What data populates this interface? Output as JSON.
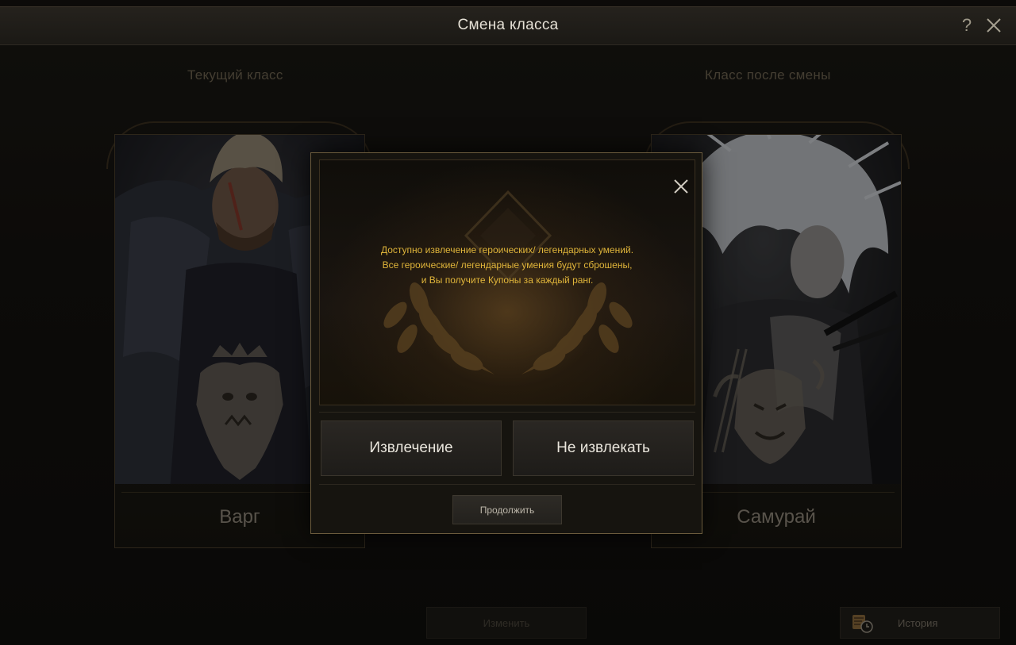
{
  "window": {
    "title": "Смена класса",
    "help_label": "?"
  },
  "current": {
    "section_label": "Текущий класс",
    "class_name": "Варг"
  },
  "target": {
    "section_label": "Класс после смены",
    "class_name": "Самурай"
  },
  "modal": {
    "message_lines": [
      "Доступно извлечение героических/ легендарных умений.",
      "Все героические/ легендарные умения будут сброшены,",
      "и Вы получите Купоны за каждый ранг."
    ],
    "extract_label": "Извлечение",
    "skip_label": "Не извлекать",
    "continue_label": "Продолжить"
  },
  "footer": {
    "change_label": "Изменить",
    "history_label": "История"
  },
  "colors": {
    "accent_gold": "#e0b53a",
    "frame_gold": "#6a5a3c",
    "background": "#14120f"
  },
  "icons": {
    "help": "question-mark-icon",
    "close": "close-x-icon",
    "history": "scroll-clock-icon",
    "varg_emblem": "beast-crest-icon",
    "samurai_emblem": "oni-mask-crest-icon"
  }
}
